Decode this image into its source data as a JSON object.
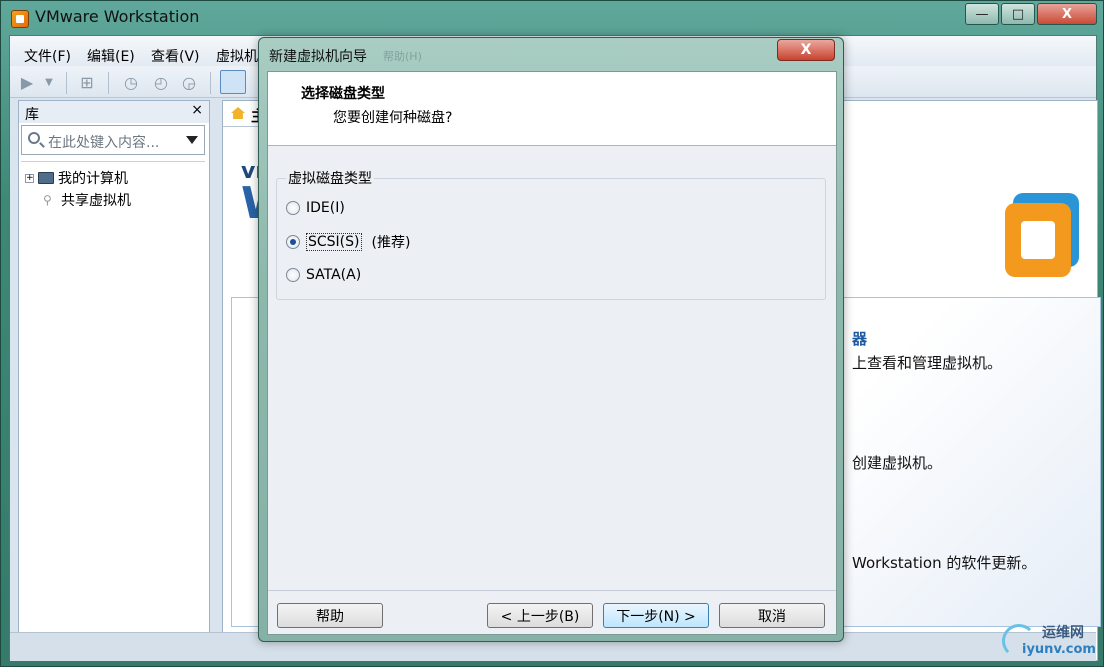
{
  "main_window": {
    "title": "VMware Workstation",
    "controls": {
      "minimize": "—",
      "maximize": "□",
      "close": "X"
    }
  },
  "menubar": {
    "items": [
      "文件(F)",
      "编辑(E)",
      "查看(V)",
      "虚拟机"
    ]
  },
  "library": {
    "title": "库",
    "close": "×",
    "search_placeholder": "在此处键入内容...",
    "tree": [
      {
        "label": "我的计算机",
        "expander": "+"
      },
      {
        "label": "共享虚拟机"
      }
    ]
  },
  "home": {
    "tab_label": "主",
    "brand_lines": [
      "vm",
      "W"
    ],
    "texts": [
      "器",
      "上查看和管理虚拟机。",
      "创建虚拟机。",
      "Workstation 的软件更新。"
    ]
  },
  "dialog": {
    "title": "新建虚拟机向导",
    "title_faint": "帮助(H)",
    "close": "X",
    "heading": "选择磁盘类型",
    "subheading": "您要创建何种磁盘?",
    "group_label": "虚拟磁盘类型",
    "options": [
      {
        "label": "IDE(I)",
        "selected": false
      },
      {
        "label": "SCSI(S)",
        "selected": true,
        "note": "(推荐)"
      },
      {
        "label": "SATA(A)",
        "selected": false
      }
    ],
    "buttons": {
      "help": "帮助",
      "back": "< 上一步(B)",
      "next": "下一步(N) >",
      "cancel": "取消"
    }
  },
  "watermark": {
    "line1": "运维网",
    "line2": "iyunv.com"
  }
}
